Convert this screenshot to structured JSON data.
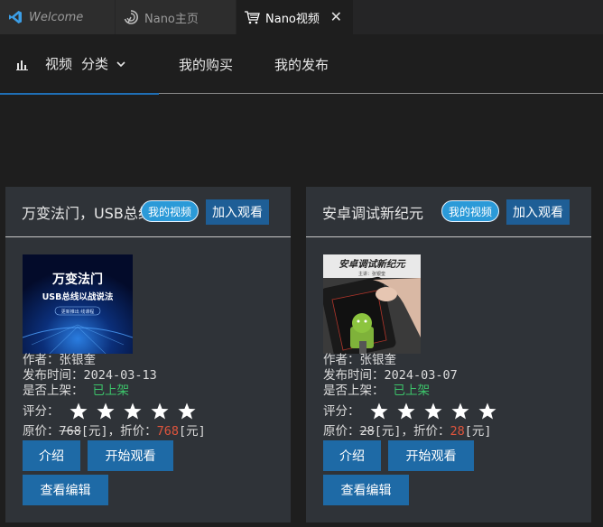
{
  "tabs": [
    {
      "label": "Welcome",
      "icon": "vscode-logo-icon",
      "active": false
    },
    {
      "label": "Nano主页",
      "icon": "swirl-logo-icon",
      "active": false
    },
    {
      "label": "Nano视频",
      "icon": "cart-icon",
      "active": true,
      "close": "✕"
    }
  ],
  "nav": {
    "video": "视频",
    "category": "分类",
    "my_purchases": "我的购买",
    "my_publications": "我的发布"
  },
  "cards": [
    {
      "title": "万变法门，USB总线以战说法",
      "badge": "我的视频",
      "add_label": "加入观看",
      "thumb": {
        "line1": "万变法门",
        "line2": "USB总线以战说法",
        "line3": "更新推出 线课程"
      },
      "author_label": "作者：",
      "author": "张银奎",
      "date_label": "发布时间：",
      "date": "2024-03-13",
      "listed_label": "是否上架：",
      "listed": "已上架",
      "rating_label": "评分：",
      "rating": 5,
      "price_label": "原价：",
      "price": "768",
      "unit": "[元]",
      "sep": "，",
      "discount_label": "折价：",
      "discount": "768",
      "buttons": {
        "intro": "介绍",
        "watch": "开始观看",
        "edit": "查看编辑"
      }
    },
    {
      "title": "安卓调试新纪元",
      "badge": "我的视频",
      "add_label": "加入观看",
      "thumb": {
        "line1": "安卓调试新纪元",
        "line2": "主讲：张银奎"
      },
      "author_label": "作者：",
      "author": "张银奎",
      "date_label": "发布时间：",
      "date": "2024-03-07",
      "listed_label": "是否上架：",
      "listed": "已上架",
      "rating_label": "评分：",
      "rating": 5,
      "price_label": "原价：",
      "price": "28",
      "unit": "[元]",
      "sep": "，",
      "discount_label": "折价：",
      "discount": "28",
      "buttons": {
        "intro": "介绍",
        "watch": "开始观看",
        "edit": "查看编辑"
      }
    }
  ],
  "colors": {
    "accent": "#1f6fb5",
    "badge": "#2b9ad8",
    "listed": "#3cc46a",
    "discount": "#e0553d"
  }
}
